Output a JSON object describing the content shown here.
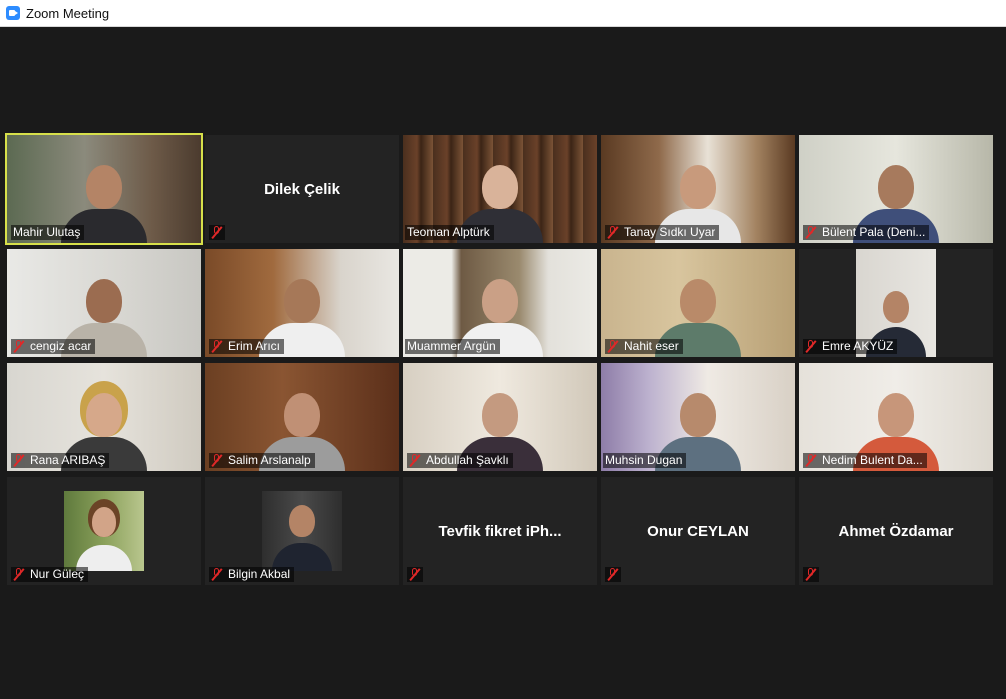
{
  "window": {
    "title": "Zoom Meeting"
  },
  "participants": [
    {
      "name": "Mahir Ulutaş",
      "muted": true
    },
    {
      "name": "Dilek Çelik",
      "muted": true
    },
    {
      "name": "Teoman Alptürk",
      "muted": false
    },
    {
      "name": "Tanay Sıdkı Uyar",
      "muted": true
    },
    {
      "name": "Bülent Pala (Deni...",
      "muted": true
    },
    {
      "name": "cengiz acar",
      "muted": true
    },
    {
      "name": "Erim Arıcı",
      "muted": true
    },
    {
      "name": "Muammer Argün",
      "muted": false
    },
    {
      "name": "Nahit eser",
      "muted": true
    },
    {
      "name": "Emre AKYÜZ",
      "muted": true
    },
    {
      "name": "Rana ARIBAŞ",
      "muted": true
    },
    {
      "name": "Salim Arslanalp",
      "muted": true
    },
    {
      "name": "Abdullah Şavklı",
      "muted": true
    },
    {
      "name": "Muhsin Dugan",
      "muted": false
    },
    {
      "name": "Nedim Bulent Da...",
      "muted": true
    },
    {
      "name": "Nur Güleç",
      "muted": true
    },
    {
      "name": "Bilgin Akbal",
      "muted": true
    },
    {
      "name": "Tevfik  fikret  iPh...",
      "muted": true
    },
    {
      "name": "Onur CEYLAN",
      "muted": true
    },
    {
      "name": "Ahmet Özdamar",
      "muted": true
    }
  ],
  "colors": {
    "active_speaker_border": "#d7e04a",
    "muted_icon": "#e02828",
    "tile_background": "#232323",
    "window_background": "#1a1a1a"
  }
}
